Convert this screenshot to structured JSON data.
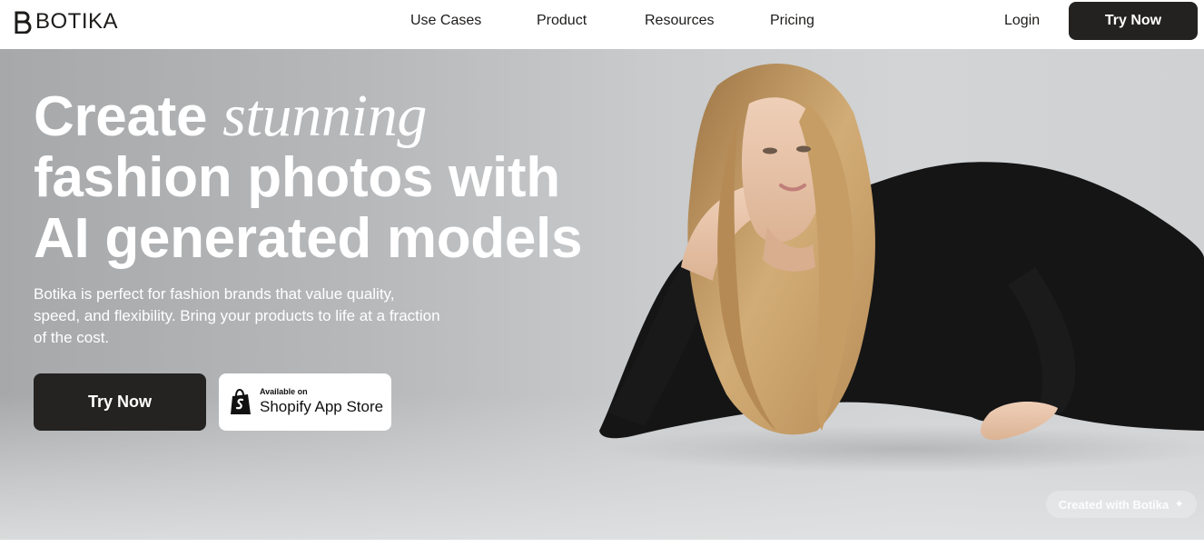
{
  "header": {
    "brand": "BOTIKA",
    "nav": [
      "Use Cases",
      "Product",
      "Resources",
      "Pricing"
    ],
    "login": "Login",
    "cta": "Try Now"
  },
  "hero": {
    "headline_start": "Create",
    "headline_accent": "stunning",
    "headline_line2": "fashion photos with",
    "headline_line3": "AI generated models",
    "subcopy": "Botika is perfect for fashion brands that value quality, speed, and flexibility. Bring your products to life at a fraction of the cost.",
    "cta": "Try Now",
    "shopify_small": "Available on",
    "shopify_big": "Shopify App Store",
    "watermark": "Created with Botika",
    "watermark_icon": "sparkle-icon"
  },
  "colors": {
    "dark": "#252322",
    "white": "#ffffff",
    "hero_bg": "#c4c6c8",
    "dress": "#161616",
    "hair": "#c8a06a",
    "skin": "#e6c2a8"
  }
}
